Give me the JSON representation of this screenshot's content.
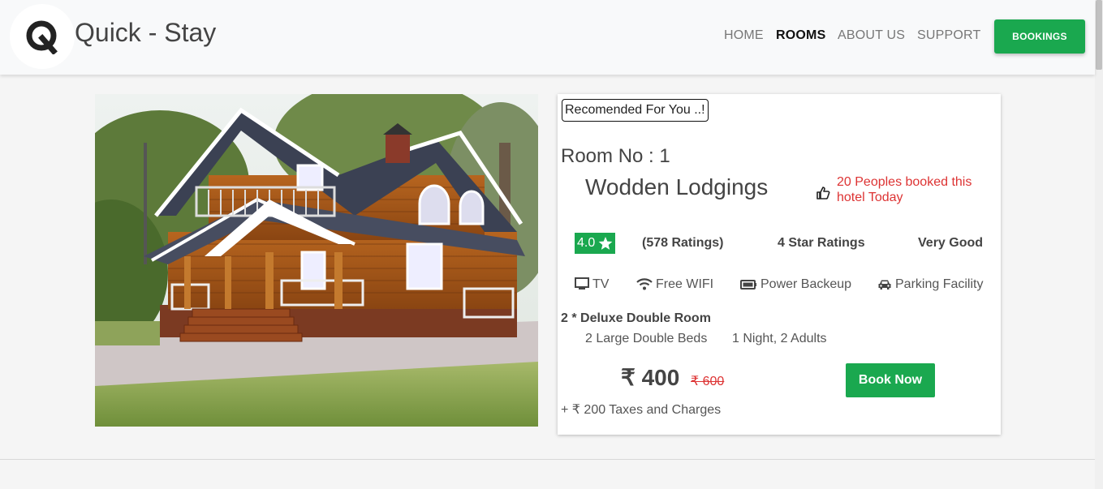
{
  "brand": {
    "logo_letter": "Q",
    "name": "Quick - Stay"
  },
  "nav": {
    "items": [
      {
        "label": "HOME",
        "active": false
      },
      {
        "label": "ROOMS",
        "active": true
      },
      {
        "label": "ABOUT US",
        "active": false
      },
      {
        "label": "SUPPORT",
        "active": false
      }
    ],
    "bookings_label": "BOOKINGS"
  },
  "room": {
    "recommend_label": "Recomended For You ..!",
    "room_no": "Room No : 1",
    "name": "Wodden Lodgings",
    "booked_text": "20 Peoples booked this hotel Today",
    "rating": "4.0",
    "ratings_count": "(578 Ratings)",
    "star_rating": "4 Star Ratings",
    "review_word": "Very Good",
    "amenities": [
      {
        "label": "TV",
        "icon": "tv-icon"
      },
      {
        "label": "Free WIFI",
        "icon": "wifi-icon"
      },
      {
        "label": "Power Backeup",
        "icon": "battery-icon"
      },
      {
        "label": "Parking Facility",
        "icon": "car-icon"
      }
    ],
    "room_type": "2 * Deluxe Double Room",
    "beds": "2 Large Double Beds",
    "stay": "1 Night, 2 Adults",
    "price": "₹ 400",
    "old_price": "₹ 600",
    "book_label": "Book Now",
    "taxes": "+ ₹ 200 Taxes and Charges"
  },
  "colors": {
    "accent": "#1aa84f",
    "alert": "#dd3333",
    "text": "#444444"
  }
}
